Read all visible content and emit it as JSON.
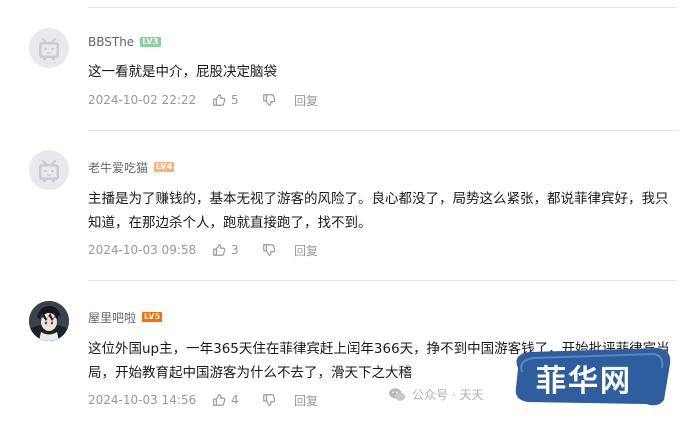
{
  "comments": [
    {
      "username": "BBSThe",
      "level": "LV3",
      "content": "这一看就是中介，屁股决定脑袋",
      "time": "2024-10-02 22:22",
      "likes": "5",
      "reply_label": "回复"
    },
    {
      "username": "老牛爱吃猫",
      "level": "LV4",
      "content": "主播是为了赚钱的，基本无视了游客的风险了。良心都没了，局势这么紧张，都说菲律宾好，我只知道，在那边杀个人，跑就直接跑了，找不到。",
      "time": "2024-10-03 09:58",
      "likes": "3",
      "reply_label": "回复"
    },
    {
      "username": "屋里吧啦",
      "level": "LV5",
      "content": "这位外国up主，一年365天住在菲律宾赶上闰年366天，挣不到中国游客钱了，开始批评菲律宾当局，开始教育起中国游客为什么不去了，滑天下之大稽",
      "time": "2024-10-03 14:56",
      "likes": "4",
      "reply_label": "回复"
    }
  ],
  "watermark": {
    "wechat_text": "公众号 · 天天",
    "logo_text": "菲华网"
  },
  "colors": {
    "text": "#18191c",
    "meta": "#9499a0",
    "lv3": "#8bd29b",
    "lv4": "#ffb37c",
    "lv5": "#ff6c00",
    "logo_bg": "#2f5e9f"
  }
}
